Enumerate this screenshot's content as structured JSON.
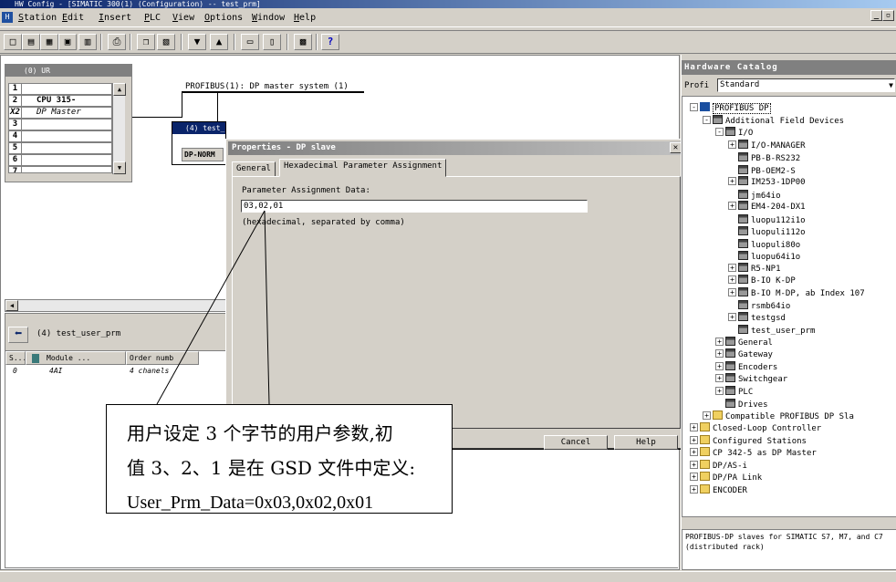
{
  "window": {
    "title": "HW Config - [SIMATIC 300(1) (Configuration) -- test_prm]"
  },
  "menu": [
    "Station",
    "Edit",
    "Insert",
    "PLC",
    "View",
    "Options",
    "Window",
    "Help"
  ],
  "toolbar": {
    "icons": [
      "new-icon",
      "open-icon",
      "station-icon",
      "save-icon",
      "compile-icon",
      "print-icon",
      "copy-icon",
      "paste-icon",
      "download-icon",
      "upload-icon",
      "catalog-icon",
      "overview-icon",
      "network-icon",
      "help-icon"
    ]
  },
  "rack": {
    "title": "(0) UR",
    "rows": [
      {
        "slot": "1",
        "module": ""
      },
      {
        "slot": "2",
        "module": "CPU 315-"
      },
      {
        "slot": "X2",
        "module": "DP Master"
      },
      {
        "slot": "3",
        "module": ""
      },
      {
        "slot": "4",
        "module": ""
      },
      {
        "slot": "5",
        "module": ""
      },
      {
        "slot": "6",
        "module": ""
      },
      {
        "slot": "7",
        "module": ""
      }
    ]
  },
  "network": {
    "bus_label": "PROFIBUS(1): DP master system (1)",
    "slave_title": "(4) test_",
    "slave_module": "DP-NORM"
  },
  "detail": {
    "title": "(4)   test_user_prm",
    "columns": [
      "S...",
      "Module ...",
      "Order numb"
    ],
    "rows": [
      {
        "slot": "0",
        "module": "4AI",
        "order": "4 chanels"
      }
    ]
  },
  "dialog": {
    "title": "Properties - DP slave",
    "tabs": [
      "General",
      "Hexadecimal Parameter Assignment"
    ],
    "field_label": "Parameter Assignment Data:",
    "field_value": "03,02,01",
    "hint": "(hexadecimal, separated by comma)",
    "cancel": "Cancel",
    "help": "Help"
  },
  "catalog": {
    "title": "Hardware Catalog",
    "profile_label": "Profi",
    "profile_value": "Standard",
    "tree": [
      {
        "text": "PROFIBUS DP",
        "level": 0,
        "pm": "-",
        "icon": "bus",
        "selected": true
      },
      {
        "text": "Additional Field Devices",
        "level": 1,
        "pm": "-",
        "icon": "dev"
      },
      {
        "text": "I/O",
        "level": 2,
        "pm": "-",
        "icon": "dev"
      },
      {
        "text": "I/O-MANAGER",
        "level": 3,
        "pm": "+",
        "icon": "dev"
      },
      {
        "text": "PB-B-RS232",
        "level": 3,
        "pm": "",
        "icon": "dev"
      },
      {
        "text": "PB-OEM2-S",
        "level": 3,
        "pm": "",
        "icon": "dev"
      },
      {
        "text": "IM253-1DP00",
        "level": 3,
        "pm": "+",
        "icon": "dev"
      },
      {
        "text": "jm64io",
        "level": 3,
        "pm": "",
        "icon": "dev"
      },
      {
        "text": "EM4-204-DX1",
        "level": 3,
        "pm": "+",
        "icon": "dev"
      },
      {
        "text": "luopu112i1o",
        "level": 3,
        "pm": "",
        "icon": "dev"
      },
      {
        "text": "luopuli112o",
        "level": 3,
        "pm": "",
        "icon": "dev"
      },
      {
        "text": "luopuli80o",
        "level": 3,
        "pm": "",
        "icon": "dev"
      },
      {
        "text": "luopu64i1o",
        "level": 3,
        "pm": "",
        "icon": "dev"
      },
      {
        "text": "R5-NP1",
        "level": 3,
        "pm": "+",
        "icon": "dev"
      },
      {
        "text": "B-IO K-DP",
        "level": 3,
        "pm": "+",
        "icon": "dev"
      },
      {
        "text": "B-IO M-DP, ab Index 107",
        "level": 3,
        "pm": "+",
        "icon": "dev"
      },
      {
        "text": "rsmb64io",
        "level": 3,
        "pm": "",
        "icon": "dev"
      },
      {
        "text": "testgsd",
        "level": 3,
        "pm": "+",
        "icon": "dev"
      },
      {
        "text": "test_user_prm",
        "level": 3,
        "pm": "",
        "icon": "dev"
      },
      {
        "text": "General",
        "level": 2,
        "pm": "+",
        "icon": "dev"
      },
      {
        "text": "Gateway",
        "level": 2,
        "pm": "+",
        "icon": "dev"
      },
      {
        "text": "Encoders",
        "level": 2,
        "pm": "+",
        "icon": "dev"
      },
      {
        "text": "Switchgear",
        "level": 2,
        "pm": "+",
        "icon": "dev"
      },
      {
        "text": "PLC",
        "level": 2,
        "pm": "+",
        "icon": "dev"
      },
      {
        "text": "Drives",
        "level": 2,
        "pm": "",
        "icon": "dev"
      },
      {
        "text": "Compatible PROFIBUS DP Sla",
        "level": 1,
        "pm": "+",
        "icon": "folder"
      },
      {
        "text": "Closed-Loop Controller",
        "level": 0,
        "pm": "+",
        "icon": "folder"
      },
      {
        "text": "Configured Stations",
        "level": 0,
        "pm": "+",
        "icon": "folder"
      },
      {
        "text": "CP 342-5 as DP Master",
        "level": 0,
        "pm": "+",
        "icon": "folder"
      },
      {
        "text": "DP/AS-i",
        "level": 0,
        "pm": "+",
        "icon": "folder"
      },
      {
        "text": "DP/PA Link",
        "level": 0,
        "pm": "+",
        "icon": "folder"
      },
      {
        "text": "ENCODER",
        "level": 0,
        "pm": "+",
        "icon": "folder"
      }
    ],
    "info": "PROFIBUS-DP slaves for SIMATIC S7, M7, and C7 (distributed rack)"
  },
  "callout": {
    "line1": "用户设定 3 个字节的用户参数,初",
    "line2": "值 3、2、1 是在 GSD 文件中定义:",
    "line3": "User_Prm_Data=0x03,0x02,0x01"
  }
}
